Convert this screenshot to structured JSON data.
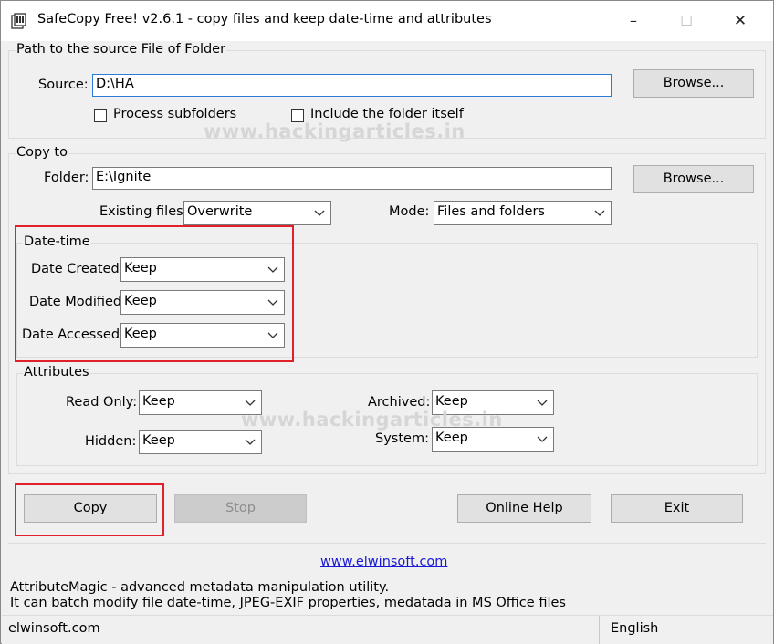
{
  "window": {
    "title": "SafeCopy Free! v2.6.1 - copy files and keep date-time and attributes",
    "minimize_symbol": "–",
    "maximize_symbol": "☐",
    "close_symbol": "✕"
  },
  "source_group": {
    "label": "Path to the source File of Folder",
    "source_label": "Source:",
    "source_value": "D:\\HA",
    "browse_label": "Browse...",
    "process_subfolders_label": "Process subfolders",
    "process_subfolders_checked": false,
    "include_folder_label": "Include the folder itself",
    "include_folder_checked": false
  },
  "copyto_group": {
    "label": "Copy to",
    "folder_label": "Folder:",
    "folder_value": "E:\\Ignite",
    "browse_label": "Browse...",
    "existing_files_label": "Existing files:",
    "existing_files_value": "Overwrite",
    "mode_label": "Mode:",
    "mode_value": "Files and folders"
  },
  "datetime_group": {
    "label": "Date-time",
    "created_label": "Date Created:",
    "created_value": "Keep",
    "modified_label": "Date Modified:",
    "modified_value": "Keep",
    "accessed_label": "Date Accessed:",
    "accessed_value": "Keep"
  },
  "attributes_group": {
    "label": "Attributes",
    "readonly_label": "Read Only:",
    "readonly_value": "Keep",
    "hidden_label": "Hidden:",
    "hidden_value": "Keep",
    "archived_label": "Archived:",
    "archived_value": "Keep",
    "system_label": "System:",
    "system_value": "Keep"
  },
  "actions": {
    "copy_label": "Copy",
    "stop_label": "Stop",
    "online_help_label": "Online Help",
    "exit_label": "Exit"
  },
  "footer": {
    "website_link": "www.elwinsoft.com",
    "promo_line1": "AttributeMagic - advanced metadata manipulation utility.",
    "promo_line2": "It can batch modify file date-time, JPEG-EXIF properties, medatada in MS Office files"
  },
  "statusbar": {
    "left_text": "elwinsoft.com",
    "language": "English"
  },
  "watermark": {
    "text": "www.hackingarticles.in"
  },
  "colors": {
    "highlight_red": "#e0202a",
    "link_blue": "#1a1ad6",
    "focus_blue": "#2a7ad6"
  }
}
